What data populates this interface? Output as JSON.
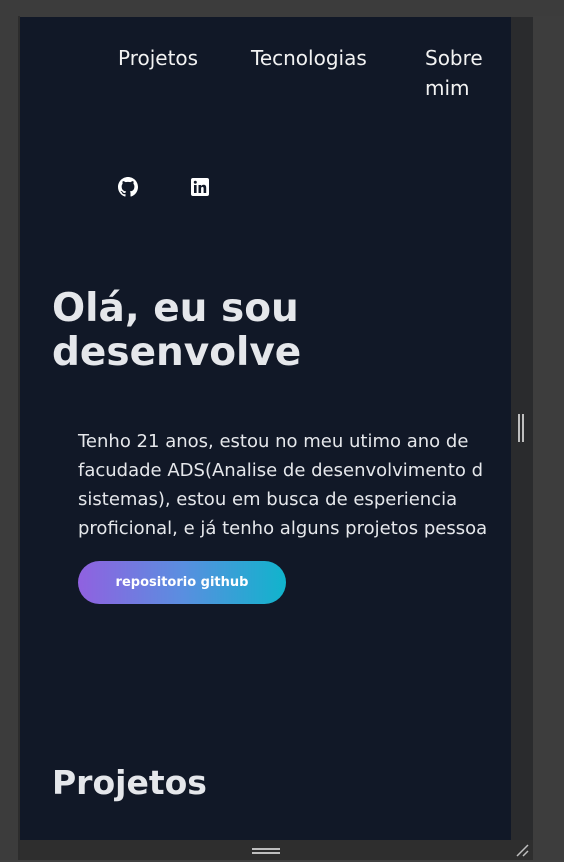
{
  "nav": {
    "projects": "Projetos",
    "technologies": "Tecnologias",
    "about": "Sobre mim"
  },
  "social": {
    "github_icon": "github-icon",
    "linkedin_icon": "linkedin-icon"
  },
  "hero": {
    "title": "Olá, eu sou\ndesenvolve",
    "description": "Tenho 21 anos, estou no meu utimo ano de\nfacudade ADS(Analise de desenvolvimento d\nsistemas), estou em busca de esperiencia\nproficional, e já tenho alguns projetos pessoa",
    "cta_label": "repositorio github"
  },
  "projects_section": {
    "title": "Projetos"
  },
  "colors": {
    "background": "#111827",
    "text": "#e5e7eb",
    "gradient_start": "#9061e0",
    "gradient_end": "#10b4cc"
  }
}
